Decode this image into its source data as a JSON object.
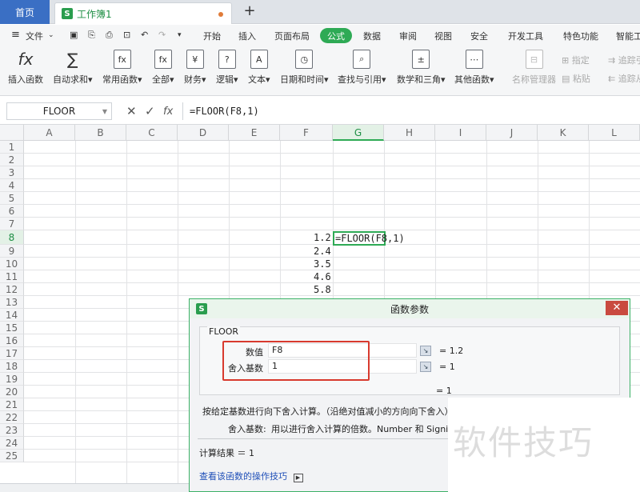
{
  "tabs": {
    "home": "首页",
    "workbook": "工作簿1",
    "plus": "+"
  },
  "menu": {
    "file": "文件",
    "items": [
      "开始",
      "插入",
      "页面布局",
      "公式",
      "数据",
      "审阅",
      "视图",
      "安全",
      "开发工具",
      "特色功能",
      "智能工"
    ],
    "active": "公式"
  },
  "ribbon": {
    "insert_fn": "插入函数",
    "autosum": "自动求和▾",
    "common_fn": "常用函数▾",
    "all": "全部▾",
    "finance": "财务▾",
    "logic": "逻辑▾",
    "text": "文本▾",
    "datetime": "日期和时间▾",
    "lookup": "查找与引用▾",
    "math": "数学和三角▾",
    "other": "其他函数▾",
    "name_mgr": "名称管理器",
    "define": "指定",
    "paste": "粘贴",
    "trace1": "追踪引",
    "trace2": "追踪从"
  },
  "formula_bar": {
    "name_box": "FLOOR",
    "cancel": "✕",
    "confirm": "✓",
    "fx": "fx",
    "formula": "=FLOOR(F8,1)"
  },
  "columns": [
    "A",
    "B",
    "C",
    "D",
    "E",
    "F",
    "G",
    "H",
    "I",
    "J",
    "K",
    "L"
  ],
  "rows": [
    "1",
    "2",
    "3",
    "4",
    "5",
    "6",
    "7",
    "8",
    "9",
    "10",
    "11",
    "12",
    "13",
    "14",
    "15",
    "16",
    "17",
    "18",
    "19",
    "20",
    "21",
    "22",
    "23",
    "24",
    "25"
  ],
  "cells": {
    "f8": "1.2",
    "f9": "2.4",
    "f10": "3.5",
    "f11": "4.6",
    "f12": "5.8",
    "g8": "=FLOOR(F8,1)"
  },
  "dialog": {
    "title": "函数参数",
    "close": "✕",
    "fn_name": "FLOOR",
    "arg1_label": "数值",
    "arg1_value": "F8",
    "arg1_result": "= 1.2",
    "arg2_label": "舍入基数",
    "arg2_value": "1",
    "arg2_result": "= 1",
    "total_result": "= 1",
    "description": "按给定基数进行向下舍入计算。（沿绝对值减小的方向向下舍入）",
    "arg_help_label": "舍入基数:",
    "arg_help": "用以进行舍入计算的倍数。Number 和 Signif",
    "result_label": "计算结果 ＝ 1",
    "help_link": "查看该函数的操作技巧"
  },
  "watermark": "软件技巧",
  "colors": {
    "accent": "#2eaa55",
    "home_tab": "#3a6fc4",
    "highlight_box": "#d83a2e"
  }
}
